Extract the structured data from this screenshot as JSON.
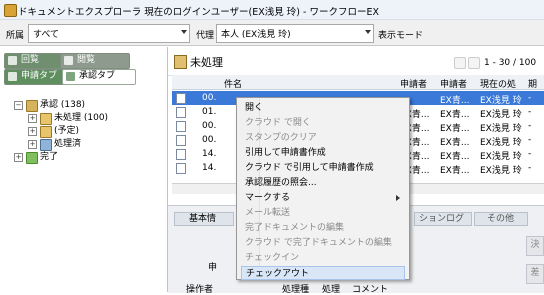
{
  "window": {
    "title": "ドキュメントエクスプローラ 現在のログインユーザー(EX浅見 玲) - ワークフローEX"
  },
  "filter": {
    "scope_label": "所属",
    "scope_value": "すべて",
    "proxy_label": "代理",
    "proxy_value": "本人 (EX浅見 玲)",
    "display_mode_label": "表示モード"
  },
  "left_tabs": {
    "circulate": "回覧",
    "view": "閲覧",
    "apply": "申請タブ",
    "approve": "承認タブ"
  },
  "tree": {
    "root": "承認 (138)",
    "children": [
      "未処理 (100)",
      "(予定)",
      "処理済"
    ],
    "complete": "完了"
  },
  "list": {
    "heading": "未処理",
    "pager": "1 - 30 / 100",
    "columns": [
      "件名",
      "申請者",
      "申請者",
      "現在の処",
      "期"
    ],
    "rows": [
      {
        "id": "00.",
        "c1": "",
        "c2": "EX青...",
        "c3": "EX浅見 玲",
        "c4": "-"
      },
      {
        "id": "01.",
        "c1": "EX青...",
        "c2": "EX青...",
        "c3": "EX浅見 玲",
        "c4": "-"
      },
      {
        "id": "00.",
        "c1": "EX青...",
        "c2": "EX青...",
        "c3": "EX浅見 玲",
        "c4": "-"
      },
      {
        "id": "00.",
        "c1": "EX青...",
        "c2": "EX青...",
        "c3": "EX浅見 玲",
        "c4": "-"
      },
      {
        "id": "14.",
        "c1": "EX青...",
        "c2": "EX青...",
        "c3": "EX浅見 玲",
        "c4": "-"
      },
      {
        "id": "14.",
        "c1": "EX青...",
        "c2": "EX青...",
        "c3": "EX浅見 玲",
        "c4": "-"
      }
    ]
  },
  "detail": {
    "tabs": [
      "基本情",
      "ションログ",
      "その他"
    ],
    "label_a": "申",
    "footer_cols": [
      "操作者",
      "処理種",
      "処理",
      "コメント"
    ],
    "side_btn1": "決",
    "side_btn2": "差"
  },
  "context_menu": {
    "items": [
      {
        "label": "開く",
        "enabled": true
      },
      {
        "label": "クラウド で開く",
        "enabled": false
      },
      {
        "label": "スタンプのクリア",
        "enabled": false
      },
      {
        "label": "引用して申請書作成",
        "enabled": true
      },
      {
        "label": "クラウド で引用して申請書作成",
        "enabled": true
      },
      {
        "label": "承認履歴の照会...",
        "enabled": true
      },
      {
        "label": "マークする",
        "enabled": true,
        "submenu": true
      },
      {
        "label": "メール転送",
        "enabled": false
      },
      {
        "label": "完了ドキュメントの編集",
        "enabled": false
      },
      {
        "label": "クラウド で完了ドキュメントの編集",
        "enabled": false
      },
      {
        "label": "チェックイン",
        "enabled": false
      },
      {
        "label": "チェックアウト",
        "enabled": true,
        "highlighted": true
      }
    ]
  },
  "colors": {
    "accent": "#3a79d8",
    "tab_green": "#5f8f5f",
    "tab_gray": "#8f9a8f"
  }
}
